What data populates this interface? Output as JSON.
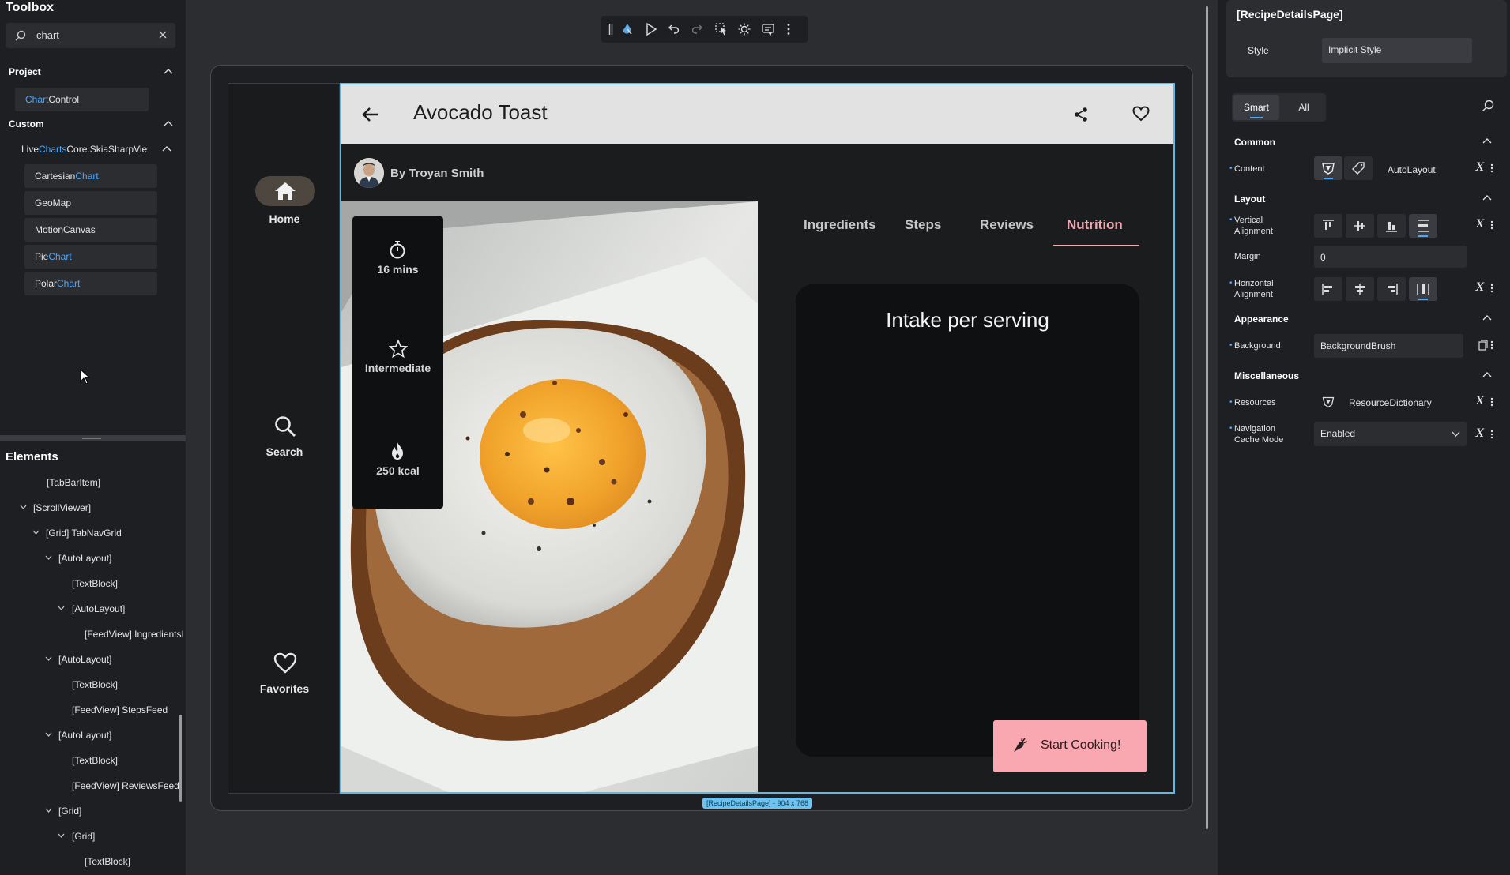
{
  "toolbox": {
    "title": "Toolbox",
    "search_value": "chart",
    "project_label": "Project",
    "project_item_pre": "Chart",
    "project_item_post": "Control",
    "custom_label": "Custom",
    "livecharts_pre": "Live",
    "livecharts_hl": "Charts",
    "livecharts_post": "Core.SkiaSharpVie",
    "items": [
      {
        "pre": "Cartesian",
        "hl": "Chart"
      },
      {
        "pre": "GeoMap",
        "hl": ""
      },
      {
        "pre": "MotionCanvas",
        "hl": ""
      },
      {
        "pre": "Pie",
        "hl": "Chart"
      },
      {
        "pre": "Polar",
        "hl": "Chart"
      }
    ]
  },
  "elements": {
    "title": "Elements",
    "rows": [
      "[TabBarItem]",
      "[ScrollViewer]",
      "[Grid] TabNavGrid",
      "[AutoLayout]",
      "[TextBlock]",
      "[AutoLayout]",
      "[FeedView] IngredientsI",
      "[AutoLayout]",
      "[TextBlock]",
      "[FeedView] StepsFeed",
      "[AutoLayout]",
      "[TextBlock]",
      "[FeedView] ReviewsFeed",
      "[Grid]",
      "[Grid]",
      "[TextBlock]"
    ]
  },
  "app": {
    "nav": {
      "home": "Home",
      "search": "Search",
      "favorites": "Favorites"
    },
    "title": "Avocado Toast",
    "author": "By Troyan Smith",
    "stats": {
      "time": "16 mins",
      "level": "Intermediate",
      "calories": "250 kcal"
    },
    "tabs": [
      "Ingredients",
      "Steps",
      "Reviews",
      "Nutrition"
    ],
    "active_tab": "Nutrition",
    "card_title": "Intake per serving",
    "cta": "Start Cooking!",
    "size_tag": "[RecipeDetailsPage] - 904 x 768",
    "colors": {
      "accent": "#f9a7b0",
      "selection": "#5fb8e6"
    }
  },
  "properties": {
    "page_title": "[RecipeDetailsPage]",
    "style_label": "Style",
    "style_value": "Implicit Style",
    "tab_smart": "Smart",
    "tab_all": "All",
    "common": "Common",
    "content_label": "Content",
    "content_value": "AutoLayout",
    "layout": "Layout",
    "vertical_alignment": "Vertical Alignment",
    "margin_label": "Margin",
    "margin_value": "0",
    "horizontal_alignment": "Horizontal Alignment",
    "appearance": "Appearance",
    "background_label": "Background",
    "background_value": "BackgroundBrush",
    "misc": "Miscellaneous",
    "resources_label": "Resources",
    "resources_value": "ResourceDictionary",
    "nav_cache_label": "Navigation Cache Mode",
    "nav_cache_value": "Enabled"
  }
}
